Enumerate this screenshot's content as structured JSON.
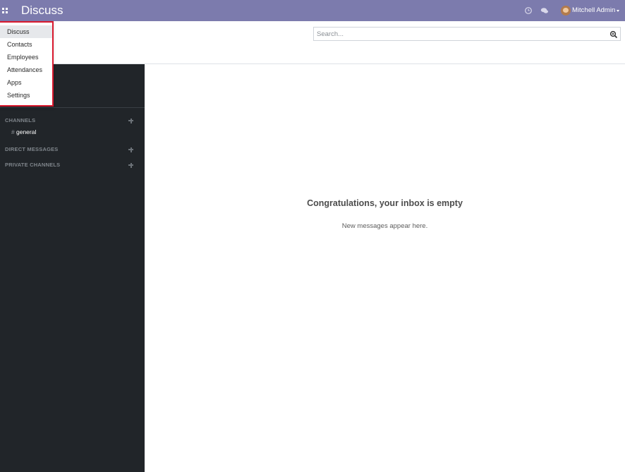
{
  "navbar": {
    "brand": "Discuss",
    "user_name": "Mitchell Admin",
    "activity_icon": "clock-icon",
    "messaging_icon": "chat-bubbles-icon",
    "color": "#7c7bad"
  },
  "apps_menu": {
    "items": [
      {
        "label": "Discuss",
        "active": true
      },
      {
        "label": "Contacts",
        "active": false
      },
      {
        "label": "Employees",
        "active": false
      },
      {
        "label": "Attendances",
        "active": false
      },
      {
        "label": "Apps",
        "active": false
      },
      {
        "label": "Settings",
        "active": false
      }
    ],
    "highlight_color": "#d9192e"
  },
  "search": {
    "placeholder": "Search..."
  },
  "sidebar": {
    "sections": [
      {
        "label": "CHANNELS"
      },
      {
        "label": "DIRECT MESSAGES"
      },
      {
        "label": "PRIVATE CHANNELS"
      }
    ],
    "channels": [
      {
        "prefix": "#",
        "name": "general"
      }
    ]
  },
  "main": {
    "empty_title": "Congratulations, your inbox is empty",
    "empty_subtitle": "New messages appear here."
  }
}
